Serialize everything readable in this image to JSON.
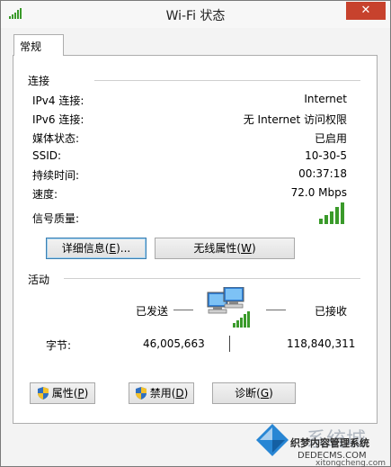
{
  "window": {
    "title": "Wi-Fi 状态",
    "close_glyph": "✕"
  },
  "tabs": [
    {
      "label": "常规"
    }
  ],
  "connection": {
    "section_title": "连接",
    "rows": [
      {
        "label": "IPv4 连接:",
        "value": "Internet"
      },
      {
        "label": "IPv6 连接:",
        "value": "无 Internet 访问权限"
      },
      {
        "label": "媒体状态:",
        "value": "已启用"
      },
      {
        "label": "SSID:",
        "value": "10-30-5"
      },
      {
        "label": "持续时间:",
        "value": "00:37:18"
      },
      {
        "label": "速度:",
        "value": "72.0 Mbps"
      }
    ],
    "signal_label": "信号质量:",
    "signal_bars_lit": 5,
    "signal_bars_total": 5,
    "details_button": {
      "text": "详细信息(",
      "key": "E",
      "suffix": ")..."
    },
    "wireless_button": {
      "text": "无线属性(",
      "key": "W",
      "suffix": ")"
    }
  },
  "activity": {
    "section_title": "活动",
    "sent_label": "已发送",
    "received_label": "已接收",
    "bytes_label": "字节:",
    "bytes_sent": "46,005,663",
    "bytes_received": "118,840,311"
  },
  "footer_buttons": [
    {
      "text": "属性(",
      "key": "P",
      "suffix": ")",
      "icon": "shield-icon"
    },
    {
      "text": "禁用(",
      "key": "D",
      "suffix": ")",
      "icon": "shield-icon"
    },
    {
      "text": "诊断(",
      "key": "G",
      "suffix": ")"
    }
  ],
  "watermark": {
    "line1": "系统城",
    "line2": "织梦内容管理系统",
    "line3": "DEDECMS.COM",
    "line4": "xitongcheng.com"
  },
  "colors": {
    "signal_green": "#3a9a2a",
    "close_red": "#c7422d"
  }
}
